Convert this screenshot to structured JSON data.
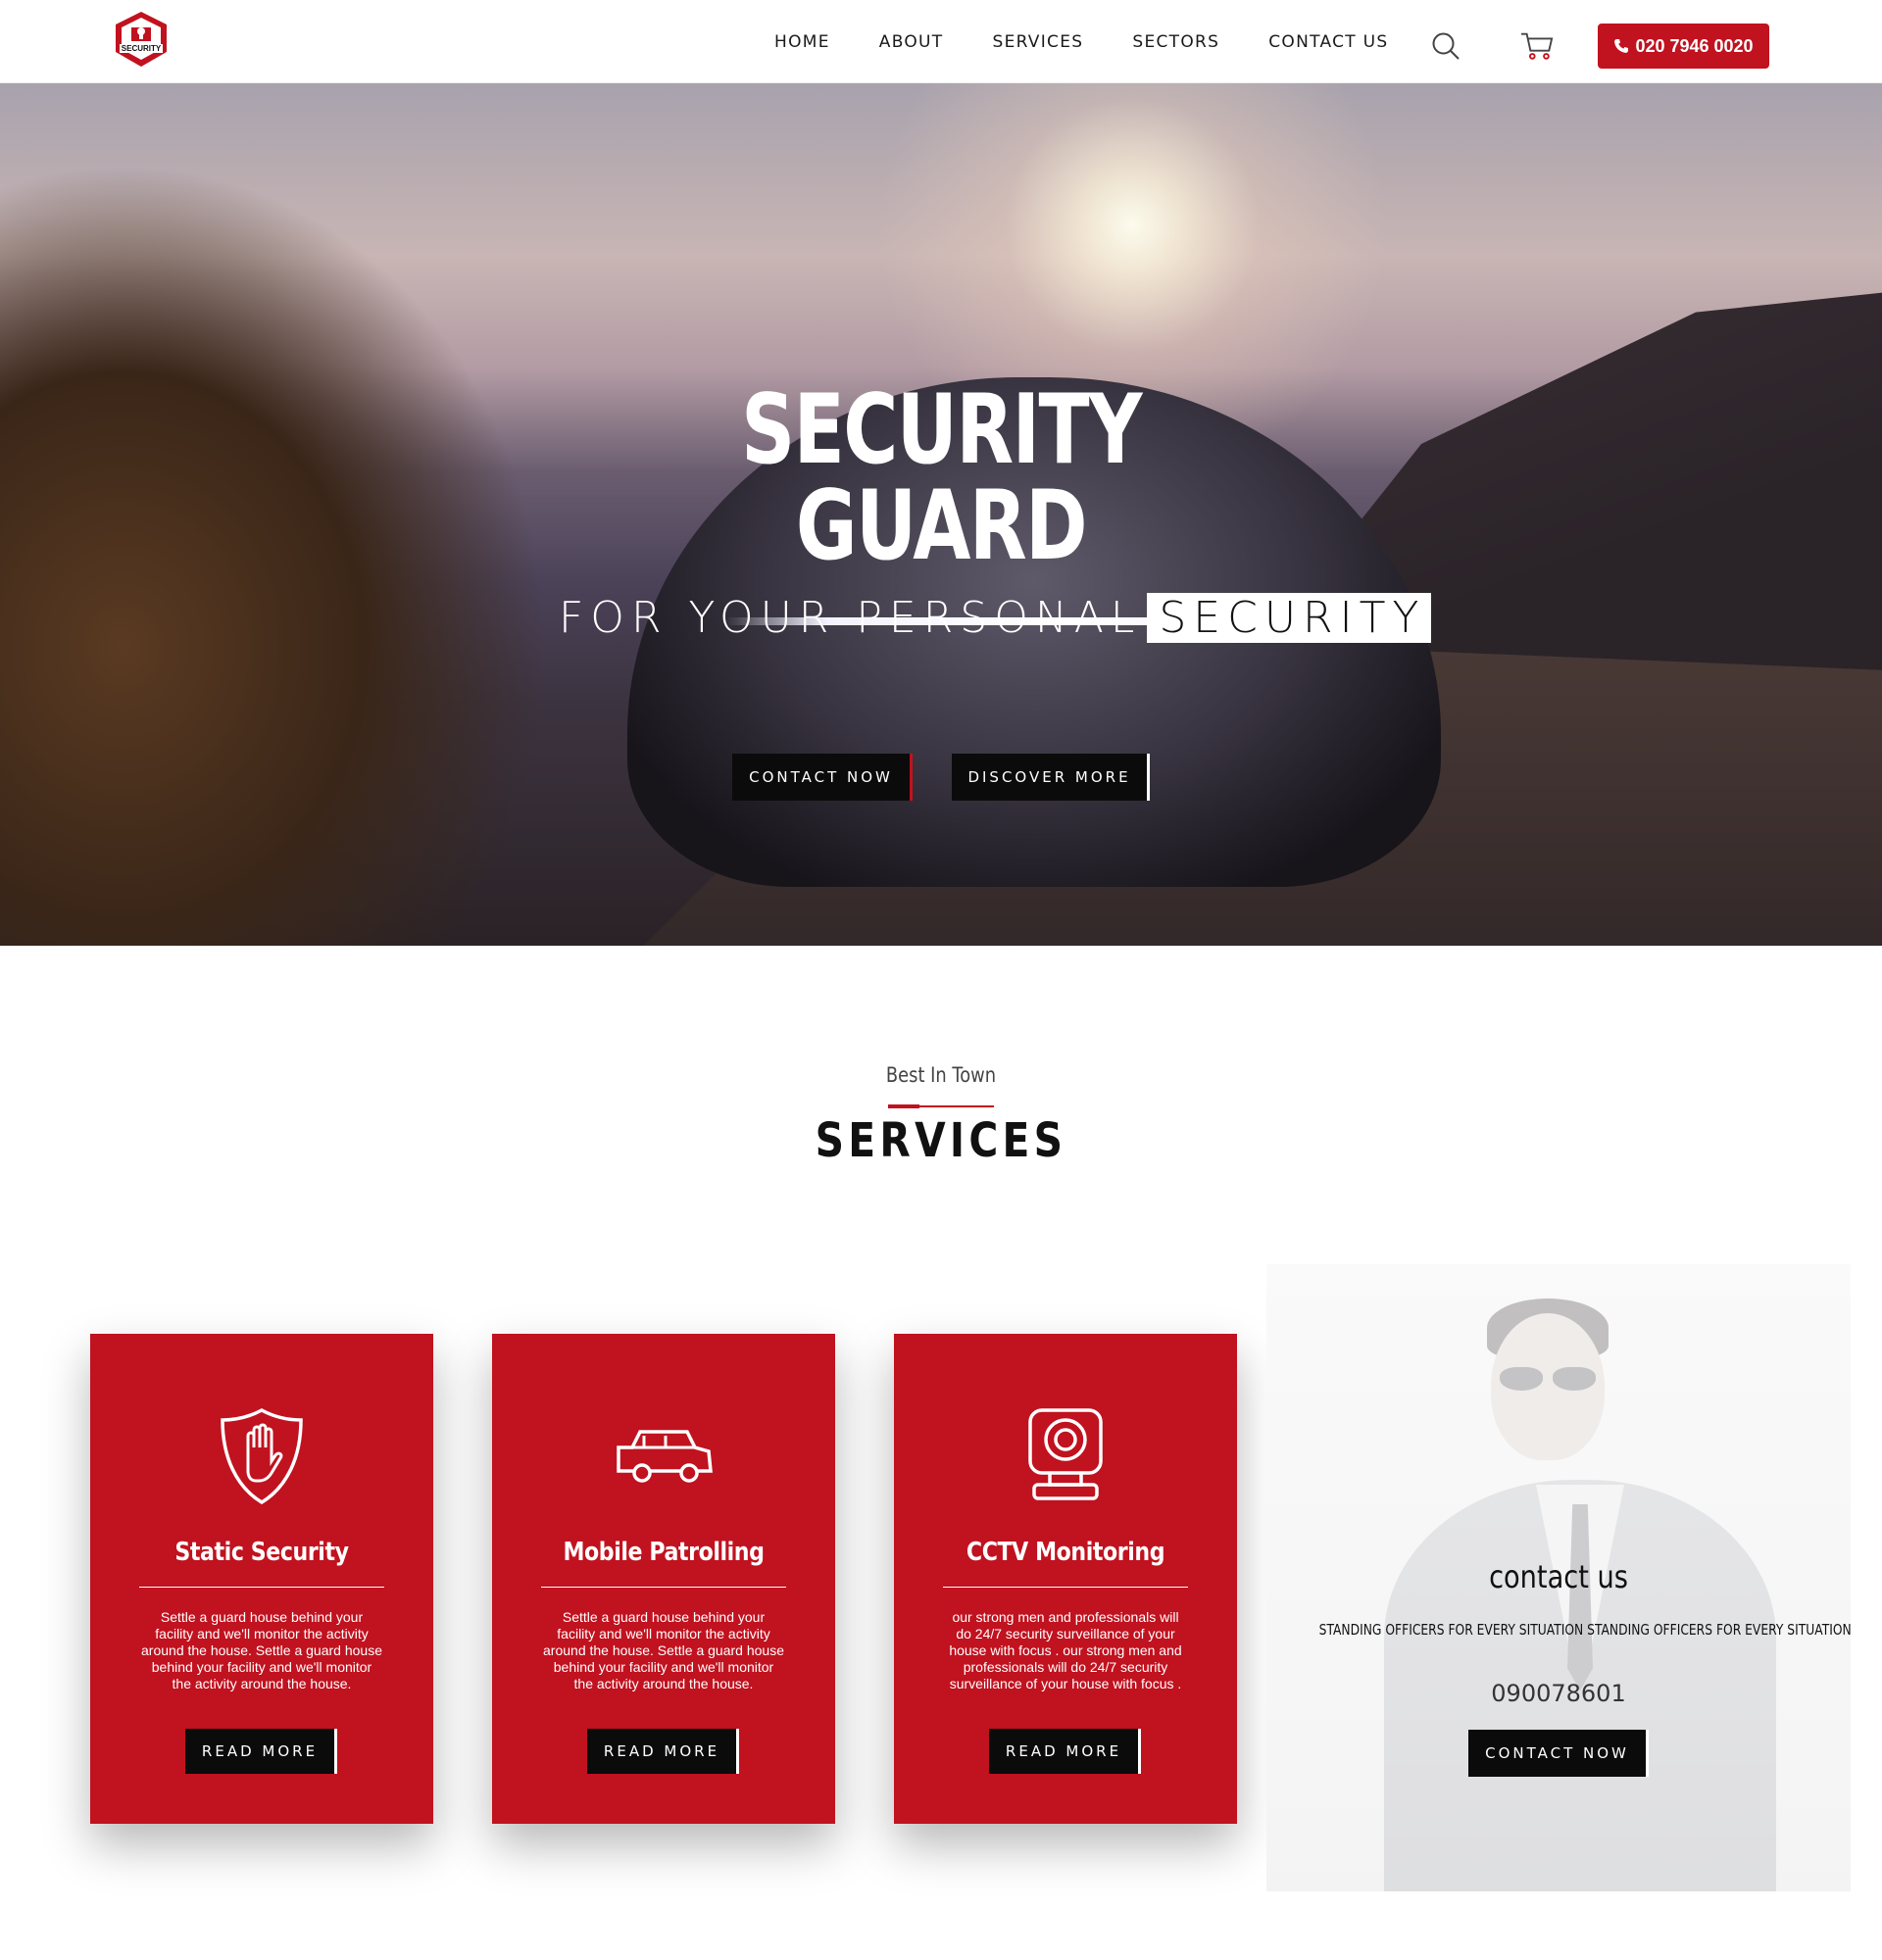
{
  "header": {
    "logo_text": "SECURITY",
    "nav": [
      "HOME",
      "ABOUT",
      "SERVICES",
      "SECTORS",
      "CONTACT US"
    ],
    "phone": "020 7946 0020",
    "icons": {
      "search": "search-icon",
      "cart": "cart-icon",
      "phone": "phone-icon"
    }
  },
  "hero": {
    "title_line1": "SECURITY",
    "title_line2": "GUARD",
    "subtitle_prefix": "FOR YOUR PERSONAL",
    "subtitle_highlight": "SECURITY",
    "buttons": {
      "contact": "CONTACT NOW",
      "discover": "DISCOVER MORE"
    }
  },
  "services": {
    "kicker": "Best In Town",
    "title": "SERVICES",
    "cards": [
      {
        "title": "Static Security",
        "icon": "shield-hand-icon",
        "text": "Settle a guard house behind your facility and we'll monitor the activity around the house. Settle a guard house behind your facility and we'll monitor the activity around the house.",
        "button": "READ MORE"
      },
      {
        "title": "Mobile Patrolling",
        "icon": "patrol-car-icon",
        "text": "Settle a guard house behind your facility and we'll monitor the activity around the house. Settle a guard house behind your facility and we'll monitor the activity around the house.",
        "button": "READ MORE"
      },
      {
        "title": "CCTV Monitoring",
        "icon": "cctv-camera-icon",
        "text": "our strong men and professionals will do 24/7 security surveillance of your house with focus . our strong men and professionals will do 24/7 security surveillance of your house with focus .",
        "button": "READ MORE"
      }
    ],
    "contact": {
      "title": "contact us",
      "tagline": "STANDING OFFICERS FOR EVERY SITUATION STANDING OFFICERS FOR EVERY SITUATION",
      "number": "090078601",
      "button": "CONTACT NOW"
    }
  },
  "colors": {
    "accent": "#c1121f",
    "dark": "#0b0b0b",
    "white": "#ffffff"
  }
}
